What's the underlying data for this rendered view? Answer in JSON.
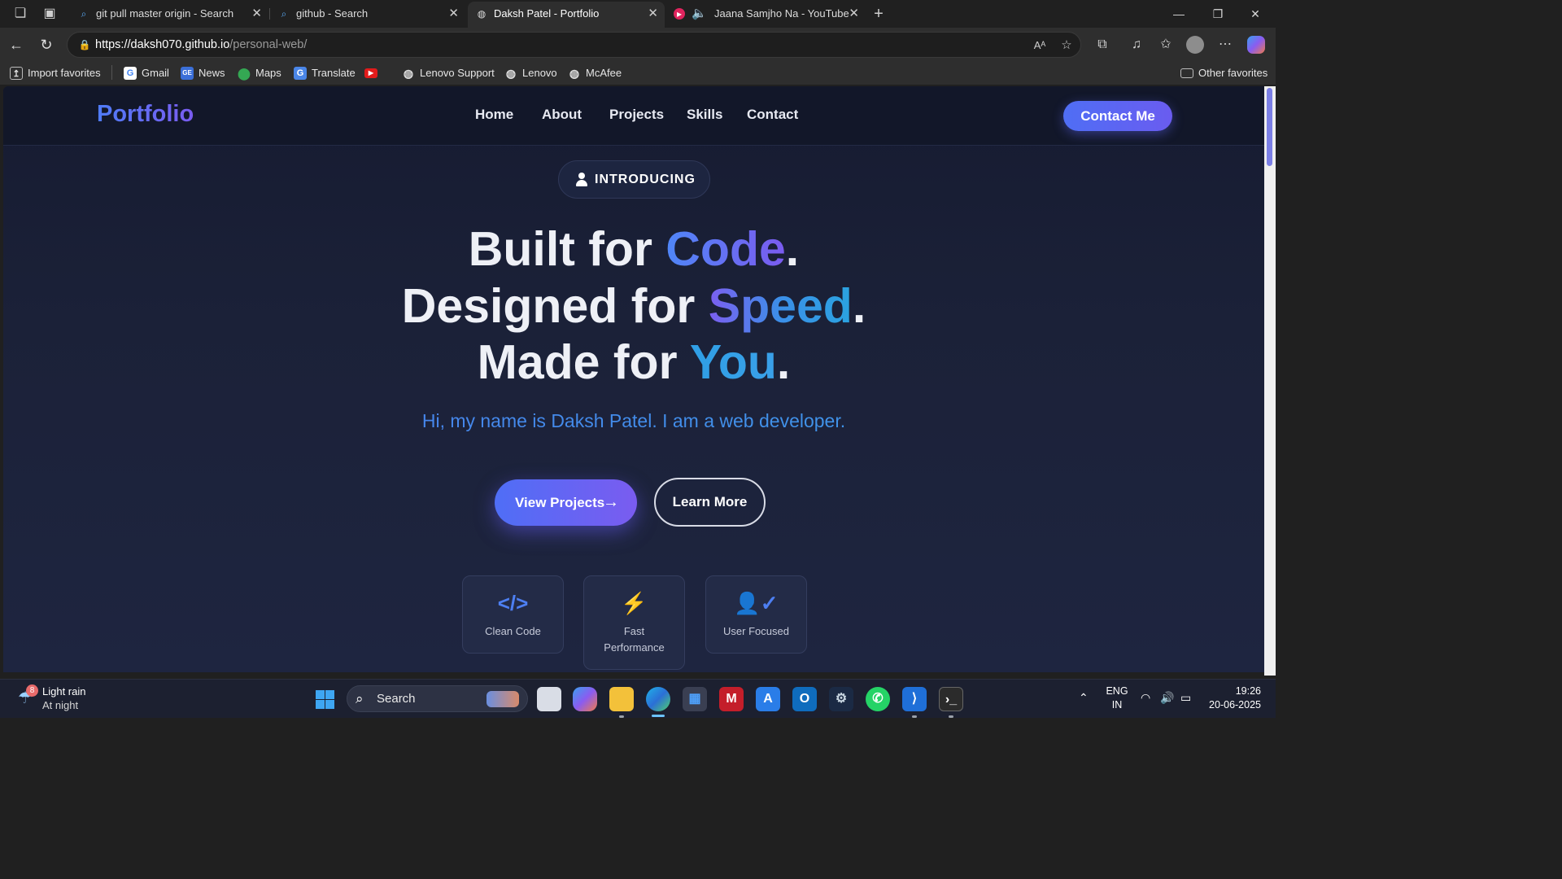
{
  "browser": {
    "tabs": [
      {
        "title": "git pull master origin - Search",
        "favicon": "search-icon"
      },
      {
        "title": "github - Search",
        "favicon": "search-icon"
      },
      {
        "title": "Daksh Patel - Portfolio",
        "favicon": "globe-icon"
      },
      {
        "title": "Jaana Samjho Na - YouTube",
        "favicon": "youtube-icon"
      }
    ],
    "url_host": "https://daksh070.github.io",
    "url_path": "/personal-web/",
    "favorites": [
      {
        "label": "Import favorites",
        "icon": "import-icon"
      },
      {
        "label": "Gmail",
        "icon": "google-icon"
      },
      {
        "label": "News",
        "icon": "news-icon"
      },
      {
        "label": "Maps",
        "icon": "maps-icon"
      },
      {
        "label": "Translate",
        "icon": "translate-icon"
      },
      {
        "label": "",
        "icon": "youtube-icon"
      },
      {
        "label": "Lenovo Support",
        "icon": "globe-icon"
      },
      {
        "label": "Lenovo",
        "icon": "globe-icon"
      },
      {
        "label": "McAfee",
        "icon": "globe-icon"
      }
    ],
    "other_favorites": "Other favorites"
  },
  "site": {
    "logo": "Portfolio",
    "nav": [
      "Home",
      "About",
      "Projects",
      "Skills",
      "Contact"
    ],
    "contact_button": "Contact Me",
    "badge": "INTRODUCING",
    "headline": [
      {
        "pre": "Built for ",
        "accent": "Code",
        "post": "."
      },
      {
        "pre": "Designed for ",
        "accent": "Speed",
        "post": "."
      },
      {
        "pre": "Made for ",
        "accent": "You",
        "post": "."
      }
    ],
    "subtitle": "Hi, my name is Daksh Patel. I am a web developer.",
    "primary_button": "View Projects",
    "secondary_button": "Learn More",
    "features": [
      {
        "label": "Clean Code",
        "icon": "code-icon"
      },
      {
        "label": "Fast Performance",
        "icon": "bolt-icon"
      },
      {
        "label": "User Focused",
        "icon": "user-check-icon"
      }
    ]
  },
  "taskbar": {
    "weather_badge": "8",
    "weather_title": "Light rain",
    "weather_sub": "At night",
    "search_placeholder": "Search",
    "lang_top": "ENG",
    "lang_bottom": "IN",
    "time": "19:26",
    "date": "20-06-2025"
  },
  "colors": {
    "accent": "#5b6cf0",
    "page_bg": "#1b2138",
    "nav_bg": "#121729"
  }
}
